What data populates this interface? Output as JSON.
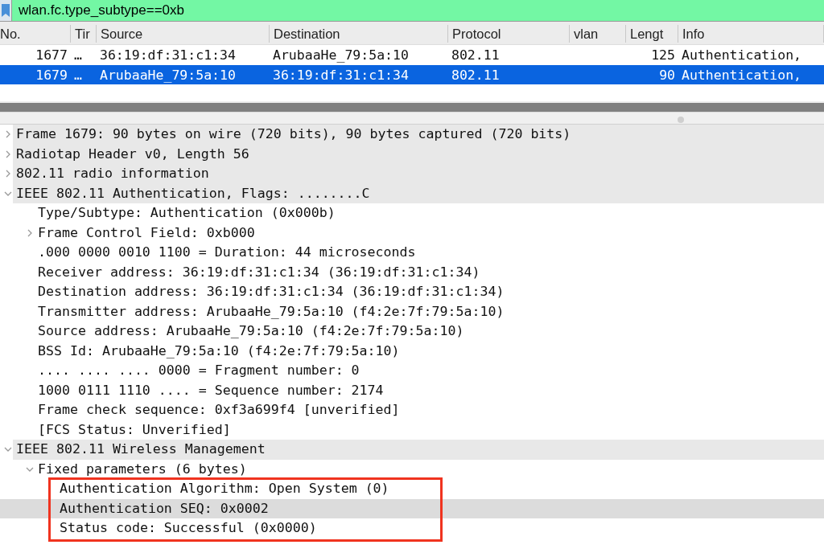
{
  "filter": {
    "value": "wlan.fc.type_subtype==0xb"
  },
  "packet_list": {
    "columns": [
      "No.",
      "Tir",
      "Source",
      "Destination",
      "Protocol",
      "vlan",
      "Lengt",
      "Info"
    ],
    "rows": [
      {
        "selected": false,
        "cells": [
          "1677",
          "…",
          "36:19:df:31:c1:34",
          "ArubaaHe_79:5a:10",
          "802.11",
          "",
          "125",
          "Authentication,"
        ]
      },
      {
        "selected": true,
        "cells": [
          "1679",
          "…",
          "ArubaaHe_79:5a:10",
          "36:19:df:31:c1:34",
          "802.11",
          "",
          "90",
          "Authentication,"
        ]
      }
    ]
  },
  "details": [
    {
      "text": "Frame 1679: 90 bytes on wire (720 bits), 90 bytes captured (720 bits)",
      "expanded": false,
      "selected": false
    },
    {
      "text": "Radiotap Header v0, Length 56",
      "expanded": false,
      "selected": false
    },
    {
      "text": "802.11 radio information",
      "expanded": false,
      "selected": false
    },
    {
      "text": "IEEE 802.11 Authentication, Flags: ........C",
      "expanded": true,
      "selected": false,
      "children": [
        {
          "text": "Type/Subtype: Authentication (0x000b)",
          "selected": false
        },
        {
          "text": "Frame Control Field: 0xb000",
          "expanded": false,
          "selected": false
        },
        {
          "text": ".000 0000 0010 1100 = Duration: 44 microseconds",
          "selected": false
        },
        {
          "text": "Receiver address: 36:19:df:31:c1:34 (36:19:df:31:c1:34)",
          "selected": false
        },
        {
          "text": "Destination address: 36:19:df:31:c1:34 (36:19:df:31:c1:34)",
          "selected": false
        },
        {
          "text": "Transmitter address: ArubaaHe_79:5a:10 (f4:2e:7f:79:5a:10)",
          "selected": false
        },
        {
          "text": "Source address: ArubaaHe_79:5a:10 (f4:2e:7f:79:5a:10)",
          "selected": false
        },
        {
          "text": "BSS Id: ArubaaHe_79:5a:10 (f4:2e:7f:79:5a:10)",
          "selected": false
        },
        {
          "text": ".... .... .... 0000 = Fragment number: 0",
          "selected": false
        },
        {
          "text": "1000 0111 1110 .... = Sequence number: 2174",
          "selected": false
        },
        {
          "text": "Frame check sequence: 0xf3a699f4 [unverified]",
          "selected": false
        },
        {
          "text": "[FCS Status: Unverified]",
          "selected": false
        }
      ]
    },
    {
      "text": "IEEE 802.11 Wireless Management",
      "expanded": true,
      "selected": false,
      "children": [
        {
          "text": "Fixed parameters (6 bytes)",
          "expanded": true,
          "selected": false,
          "children_highlighted": true,
          "children": [
            {
              "text": "Authentication Algorithm: Open System (0)",
              "selected": false
            },
            {
              "text": "Authentication SEQ: 0x0002",
              "selected": true
            },
            {
              "text": "Status code: Successful (0x0000)",
              "selected": false
            }
          ]
        }
      ]
    }
  ]
}
